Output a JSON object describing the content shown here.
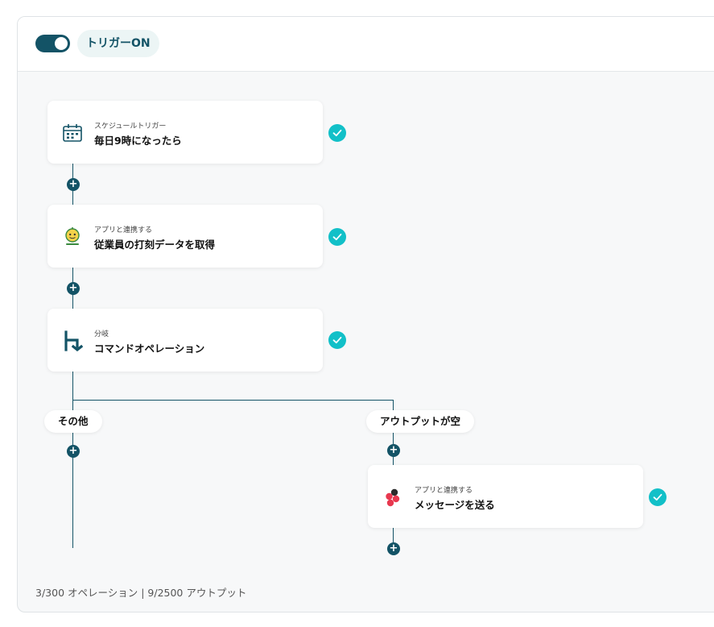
{
  "header": {
    "toggle_state": "on",
    "trigger_label": "トリガーON"
  },
  "flow": {
    "steps": [
      {
        "subtitle": "スケジュールトリガー",
        "title": "毎日9時になったら",
        "icon": "calendar-icon",
        "status": "completed"
      },
      {
        "subtitle": "アプリと連携する",
        "title": "従業員の打刻データを取得",
        "icon": "attendance-app-icon",
        "status": "completed"
      },
      {
        "subtitle": "分岐",
        "title": "コマンドオペレーション",
        "icon": "branch-icon",
        "status": "completed"
      }
    ],
    "branches": [
      {
        "label": "その他"
      },
      {
        "label": "アウトプットが空"
      }
    ],
    "branch_step": {
      "subtitle": "アプリと連携する",
      "title": "メッセージを送る",
      "icon": "asana-icon",
      "status": "completed"
    }
  },
  "footer": {
    "usage": "3/300 オペレーション | 9/2500 アウトプット"
  },
  "colors": {
    "primary": "#135366",
    "check": "#12c0c8",
    "pill_bg": "#ecf5f5"
  }
}
